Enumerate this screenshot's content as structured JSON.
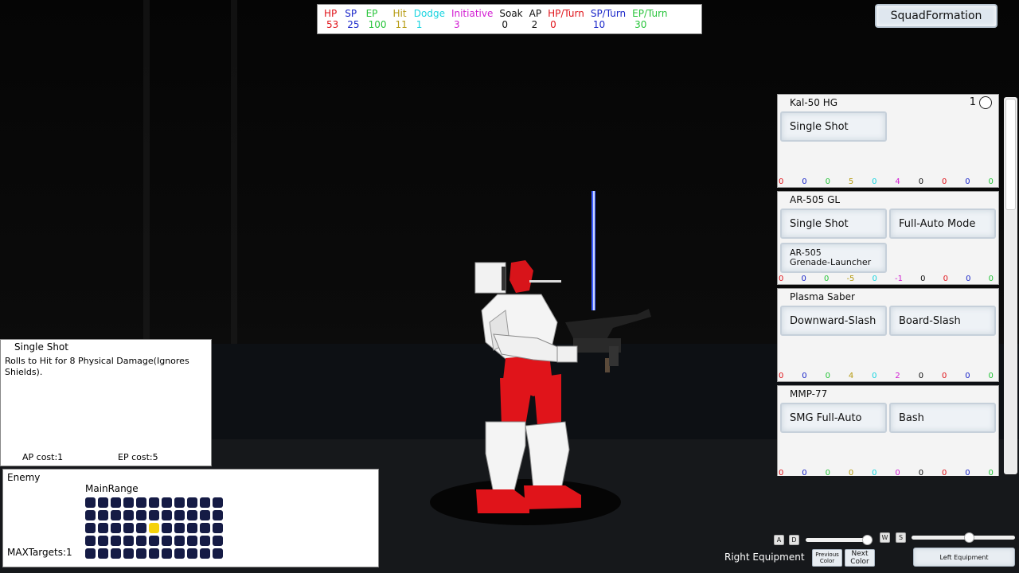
{
  "stats": [
    {
      "label": "HP",
      "value": "53",
      "color": "#e0141a"
    },
    {
      "label": "SP",
      "value": "25",
      "color": "#1a26c9"
    },
    {
      "label": "EP",
      "value": "100",
      "color": "#27c43a"
    },
    {
      "label": "Hit",
      "value": "11",
      "color": "#b59a10"
    },
    {
      "label": "Dodge",
      "value": "1",
      "color": "#18d4e0"
    },
    {
      "label": "Initiative",
      "value": "3",
      "color": "#d21cd2"
    },
    {
      "label": "Soak",
      "value": "0",
      "color": "#111111"
    },
    {
      "label": "AP",
      "value": "2",
      "color": "#111111"
    },
    {
      "label": "HP/Turn",
      "value": "0",
      "color": "#e0141a"
    },
    {
      "label": "SP/Turn",
      "value": "10",
      "color": "#1a26c9"
    },
    {
      "label": "EP/Turn",
      "value": "30",
      "color": "#27c43a"
    }
  ],
  "squad_button": "SquadFormation",
  "equipment": [
    {
      "name": "Kal-50 HG",
      "count": "1",
      "actions": [
        "Single Shot"
      ],
      "nums": [
        "0",
        "0",
        "0",
        "5",
        "0",
        "4",
        "0",
        "0",
        "0",
        "0"
      ]
    },
    {
      "name": "AR-505 GL",
      "actions": [
        "Single Shot",
        "Full-Auto Mode",
        "AR-505\nGrenade-Launcher"
      ],
      "nums": [
        "0",
        "0",
        "0",
        "-5",
        "0",
        "-1",
        "0",
        "0",
        "0",
        "0"
      ]
    },
    {
      "name": "Plasma Saber",
      "actions": [
        "Downward-Slash",
        "Board-Slash"
      ],
      "nums": [
        "0",
        "0",
        "0",
        "4",
        "0",
        "2",
        "0",
        "0",
        "0",
        "0"
      ]
    },
    {
      "name": "MMP-77",
      "actions": [
        "SMG Full-Auto",
        "Bash"
      ],
      "nums": [
        "0",
        "0",
        "0",
        "0",
        "0",
        "0",
        "0",
        "0",
        "0",
        "0"
      ]
    }
  ],
  "num_colors": [
    "#e0141a",
    "#1a26c9",
    "#27c43a",
    "#b59a10",
    "#18d4e0",
    "#d21cd2",
    "#111111",
    "#e0141a",
    "#1a26c9",
    "#27c43a"
  ],
  "tooltip": {
    "title": "Single Shot",
    "description": "Rolls to Hit for 8 Physical Damage(Ignores Shields).",
    "ap_cost": "AP cost:1",
    "ep_cost": "EP cost:5"
  },
  "targeting": {
    "side": "Enemy",
    "range": "MainRange",
    "max_targets": "MAXTargets:1",
    "rows": 5,
    "cols": 11,
    "selected": [
      2,
      5
    ]
  },
  "controls": {
    "key_a": "A",
    "key_d": "D",
    "key_w": "W",
    "key_s": "S",
    "slider_ad": 0.92,
    "slider_ws": 0.55,
    "right_equipment": "Right Equipment",
    "previous_color": "Previous Color",
    "next_color": "Next Color",
    "left_equipment": "Left Equipment"
  }
}
